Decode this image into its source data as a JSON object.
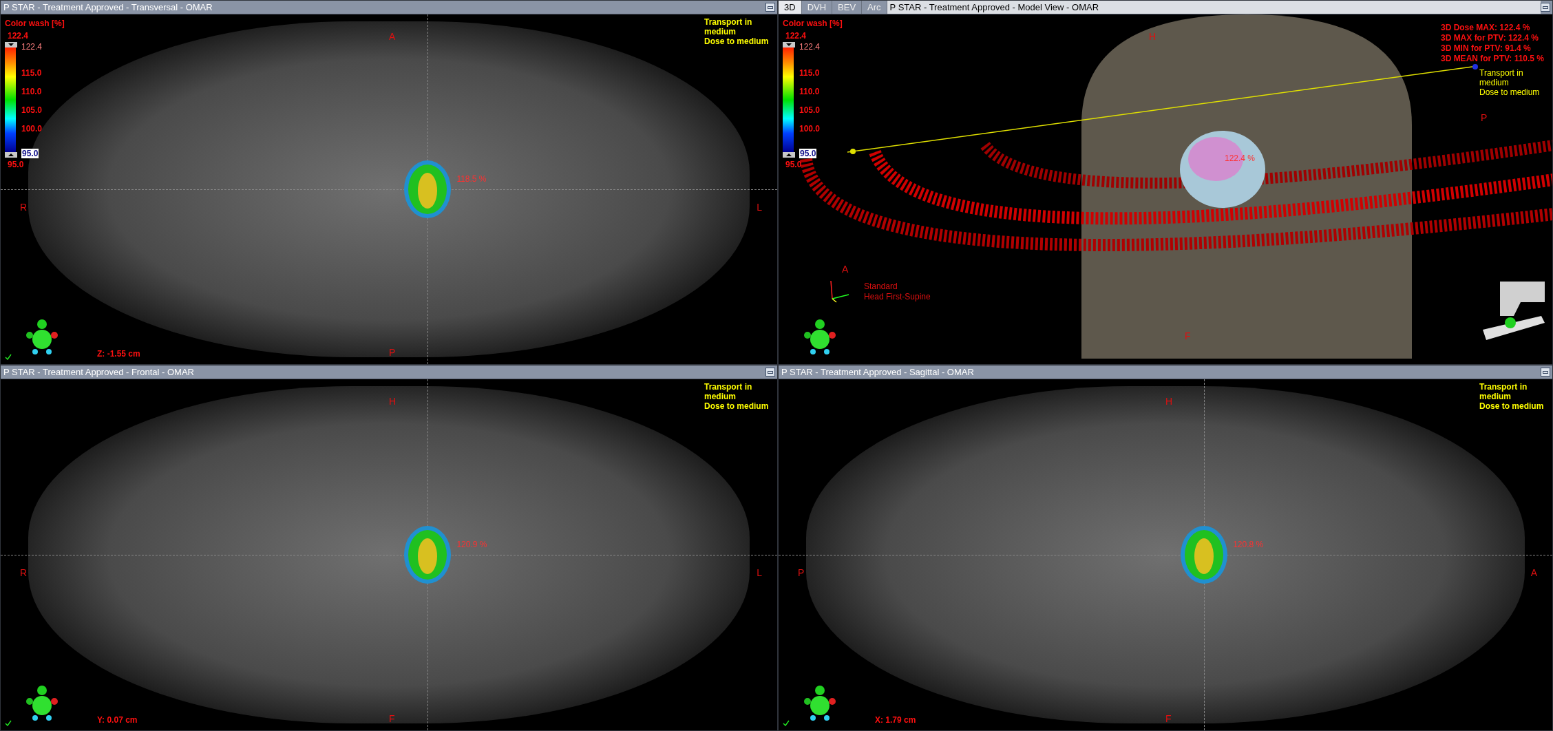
{
  "viewports": [
    {
      "kind": "slice",
      "title": "P STAR  -  Treatment Approved - Transversal - OMAR",
      "color_wash": {
        "title": "Color wash [%]",
        "max": "122.4",
        "upper": "122.4",
        "ticks": [
          "115.0",
          "110.0",
          "105.0",
          "100.0"
        ],
        "lower": "95.0",
        "min": "95.0"
      },
      "transport_note": [
        "Transport in medium",
        "Dose to medium"
      ],
      "orientation": {
        "top": "A",
        "left": "R",
        "right": "L",
        "bottom": "P"
      },
      "coordinate": "Z: -1.55 cm",
      "dose_label": "118.5 %"
    },
    {
      "kind": "model",
      "tabs": [
        {
          "label": "3D",
          "selected": true
        },
        {
          "label": "DVH",
          "selected": false
        },
        {
          "label": "BEV",
          "selected": false
        },
        {
          "label": "Arc",
          "selected": false
        }
      ],
      "title": "P STAR - Treatment Approved - Model View - OMAR",
      "color_wash": {
        "title": "Color wash [%]",
        "max": "122.4",
        "upper": "122.4",
        "ticks": [
          "115.0",
          "110.0",
          "105.0",
          "100.0"
        ],
        "lower": "95.0",
        "min": "95.0"
      },
      "stats": [
        "3D Dose MAX: 122.4 %",
        "3D MAX for PTV: 122.4 %",
        "3D MIN for PTV: 91.4 %",
        "3D MEAN for PTV: 110.5 %"
      ],
      "transport_note": [
        "Transport in medium",
        "Dose to medium"
      ],
      "orientation": {
        "top": "H",
        "bottom": "F",
        "left": "A",
        "right": "P"
      },
      "position_note": [
        "Standard",
        "Head First-Supine"
      ],
      "dose_label": "122.4 %"
    },
    {
      "kind": "slice",
      "title": "P STAR  -  Treatment Approved - Frontal - OMAR",
      "transport_note": [
        "Transport in medium",
        "Dose to medium"
      ],
      "orientation": {
        "top": "H",
        "left": "R",
        "right": "L",
        "bottom": "F"
      },
      "coordinate": "Y: 0.07 cm",
      "dose_label": "120.9 %"
    },
    {
      "kind": "slice",
      "title": "P STAR  -  Treatment Approved - Sagittal - OMAR",
      "transport_note": [
        "Transport in medium",
        "Dose to medium"
      ],
      "orientation": {
        "top": "H",
        "left": "P",
        "right": "A",
        "bottom": "F"
      },
      "coordinate": "X: 1.79 cm",
      "dose_label": "120.8 %"
    }
  ]
}
